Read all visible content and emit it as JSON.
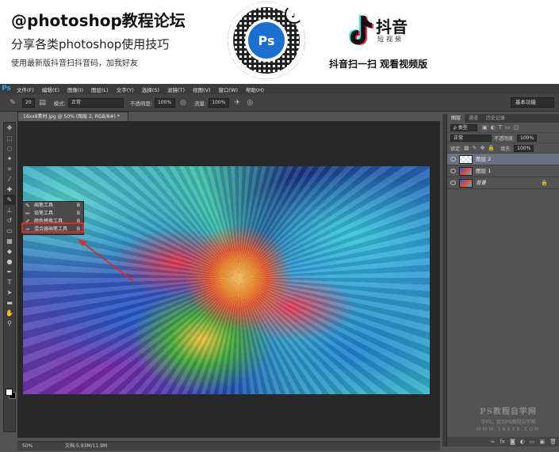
{
  "banner": {
    "title": "@photoshop教程论坛",
    "subtitle": "分享各类photoshop使用技巧",
    "hint": "使用最新版抖音扫抖音码，加我好友",
    "qr_badge": "Ps",
    "tiktok_glyph": "♪",
    "douyin_name": "抖音",
    "douyin_sub": "短视频",
    "scan_text": "抖音扫一扫 观看视频版"
  },
  "app": {
    "logo": "Ps",
    "menus": [
      "文件(F)",
      "编辑(E)",
      "图像(I)",
      "图层(L)",
      "文字(Y)",
      "选择(S)",
      "滤镜(T)",
      "视图(V)",
      "窗口(W)",
      "帮助(H)"
    ]
  },
  "options": {
    "brush_size": "20",
    "mode_label": "模式:",
    "mode_value": "正常",
    "opacity_label": "不透明度:",
    "opacity_value": "100%",
    "flow_label": "流量:",
    "flow_value": "100%",
    "workspace": "基本功能"
  },
  "document": {
    "tab_title": "16xx8素材.jpg @ 50% (图层 2, RGB/8#) *",
    "zoom": "50%",
    "doc_size": "文档:5.93M/11.9M"
  },
  "flyout": {
    "items": [
      {
        "label": "画笔工具",
        "key": "B",
        "icon": "brush-icon"
      },
      {
        "label": "铅笔工具",
        "key": "B",
        "icon": "pencil-icon"
      },
      {
        "label": "颜色替换工具",
        "key": "B",
        "icon": "color-replace-icon"
      },
      {
        "label": "混合器画笔工具",
        "key": "B",
        "icon": "mixer-brush-icon"
      }
    ],
    "highlight_color": "#e02a22"
  },
  "layers_panel": {
    "tabs": [
      "图层",
      "通道",
      "历史记录"
    ],
    "filter_kind": "ρ 类型",
    "blend_mode": "正常",
    "opacity_label": "不透明度:",
    "opacity_value": "100%",
    "lock_label": "锁定:",
    "fill_label": "填充:",
    "fill_value": "100%",
    "layers": [
      {
        "name": "图层 2",
        "selected": true
      },
      {
        "name": "图层 1",
        "selected": false
      },
      {
        "name": "背景",
        "selected": false,
        "locked": true
      }
    ]
  },
  "watermark": {
    "line1": "PS教程自学网",
    "line2": "学PS，就到PS教程自学网",
    "line3": "WWW.16XX8.COM"
  },
  "colors": {
    "accent_blue": "#1b6fd1",
    "ps_dark": "#535353",
    "highlight_red": "#e02a22"
  }
}
